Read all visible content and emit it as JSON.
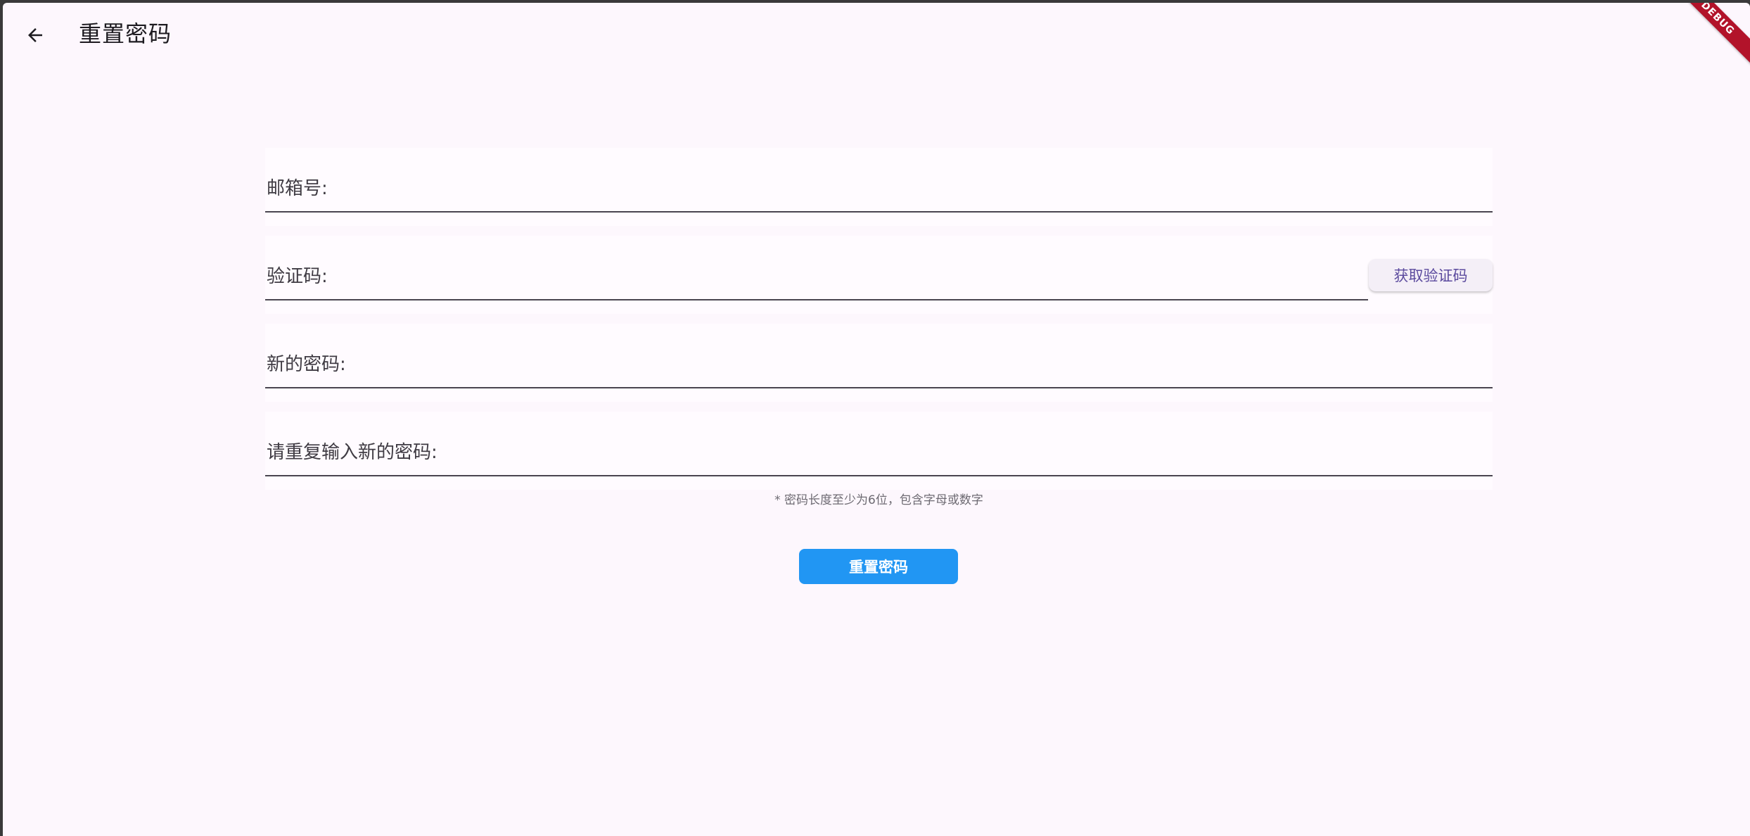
{
  "appbar": {
    "title": "重置密码",
    "back_icon": "arrow-left-icon"
  },
  "form": {
    "email_label": "邮箱号:",
    "email_value": "",
    "code_label": "验证码:",
    "code_value": "",
    "get_code_button": "获取验证码",
    "new_password_label": "新的密码:",
    "new_password_value": "",
    "repeat_password_label": "请重复输入新的密码:",
    "repeat_password_value": ""
  },
  "hint": "* 密码长度至少为6位，包含字母或数字",
  "submit_button": "重置密码",
  "debug_banner": "DEBUG",
  "colors": {
    "background": "#fdf7fd",
    "primary_button": "#2196f3",
    "debug_banner": "#b2132a"
  }
}
